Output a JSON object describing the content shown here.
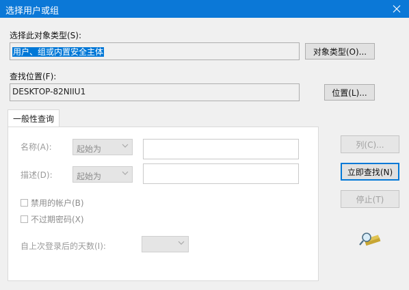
{
  "window": {
    "title": "选择用户或组",
    "close_icon": "close-icon"
  },
  "object_type": {
    "label": "选择此对象类型(S):",
    "value": "用户、组或内置安全主体",
    "button_label": "对象类型(O)..."
  },
  "location": {
    "label": "查找位置(F):",
    "value": "DESKTOP-82NIIU1",
    "button_label": "位置(L)..."
  },
  "tab": {
    "label": "一般性查询"
  },
  "query": {
    "name_label": "名称(A):",
    "name_mode": "起始为",
    "desc_label": "描述(D):",
    "desc_mode": "起始为",
    "disabled_accounts_label": "禁用的帐户(B)",
    "non_expiring_label": "不过期密码(X)",
    "days_label": "自上次登录后的天数(I):"
  },
  "buttons": {
    "columns": "列(C)...",
    "find_now": "立即查找(N)",
    "stop": "停止(T)"
  },
  "icons": {
    "search_animation": "find-search-icon"
  }
}
